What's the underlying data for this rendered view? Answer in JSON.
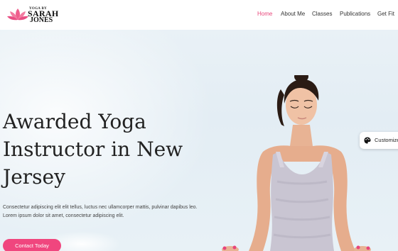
{
  "logo": {
    "small": "YOGA BY",
    "line1": "SARAH",
    "line2": "JONES"
  },
  "nav": {
    "items": [
      "Home",
      "About Me",
      "Classes",
      "Publications",
      "Get Fit"
    ],
    "active_index": 0
  },
  "hero": {
    "headline": "Awarded Yoga Instructor in New Jersey",
    "description_line1": "Consectetur adipiscing elit elit tellus, luctus nec ullamcorper mattis, pulvinar dapibus leo.",
    "description_line2": "Lorem ipsum dolor sit amet, consectetur adipiscing elit.",
    "cta_label": "Contact Today"
  },
  "customize": {
    "label": "Customize"
  },
  "colors": {
    "accent": "#f0467e",
    "nav_active": "#e8457a",
    "text": "#222222"
  },
  "icons": {
    "logo": "lotus-icon",
    "customize": "palette-icon"
  }
}
